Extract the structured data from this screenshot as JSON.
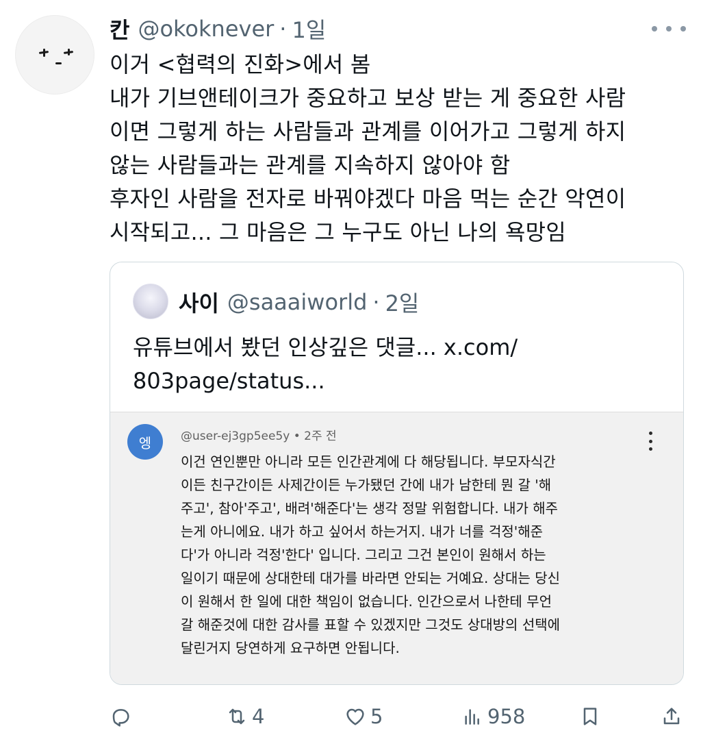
{
  "tweet": {
    "author_name": "칸",
    "author_handle": "@okoknever",
    "separator": "·",
    "time": "1일",
    "lines": [
      "이거 <협력의 진화>에서 봄",
      "내가 기브앤테이크가 중요하고 보상 받는 게 중요한 사람",
      "이면 그렇게 하는 사람들과 관계를 이어가고 그렇게 하지",
      "않는 사람들과는 관계를 지속하지 않아야 함",
      "후자인 사람을 전자로 바꿔야겠다 마음 먹는 순간 악연이",
      "시작되고... 그 마음은 그 누구도 아닌 나의 욕망임"
    ]
  },
  "quote": {
    "author_name": "사이",
    "author_handle": "@saaaiworld",
    "separator": "·",
    "time": "2일",
    "lines": [
      "유튜브에서 봤던 인상깊은 댓글... x.com/",
      "803page/status..."
    ]
  },
  "youtube_comment": {
    "avatar_letter": "엥",
    "meta": "@user-ej3gp5ee5y • 2주 전",
    "lines": [
      "이건 연인뿐만 아니라 모든 인간관계에 다 해당됩니다. 부모자식간",
      "이든 친구간이든 사제간이든 누가됐던 간에 내가 남한테 뭔 갈 '해",
      "주고', 참아'주고', 배려'해준다'는 생각 정말 위험합니다. 내가 해주",
      "는게 아니에요. 내가 하고 싶어서 하는거지. 내가 너를 걱정'해준",
      "다'가 아니라 걱정'한다' 입니다. 그리고 그건 본인이 원해서 하는",
      "일이기 때문에 상대한테 대가를 바라면 안되는 거예요. 상대는 당신",
      "이 원해서 한 일에 대한 책임이 없습니다. 인간으로서 나한테 무언",
      "갈 해준것에 대한 감사를 표할 수 있겠지만 그것도 상대방의 선택에",
      "달린거지 당연하게 요구하면 안됩니다."
    ]
  },
  "actions": {
    "reply_count": "",
    "retweet_count": "4",
    "like_count": "5",
    "view_count": "958"
  },
  "icons": [
    "more-icon",
    "reply-icon",
    "retweet-icon",
    "like-icon",
    "views-icon",
    "bookmark-icon",
    "share-icon",
    "kebab-icon"
  ],
  "colors": {
    "secondary_text": "#536471",
    "card_border": "#cfd9de",
    "yt_avatar": "#3f7ed1"
  }
}
